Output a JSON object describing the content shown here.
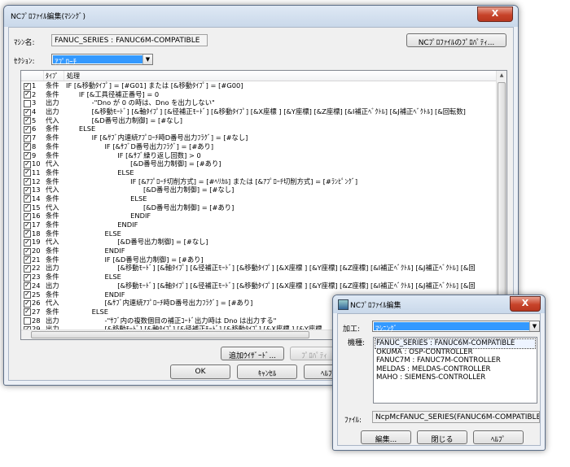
{
  "main_window": {
    "title": "NCﾌﾟﾛﾌｧｲﾙ編集(ﾏｼﾝｸﾞ)",
    "close_glyph": "X",
    "machine_label": "ﾏｼﾝ名:",
    "machine_value": "FANUC_SERIES : FANUC6M-COMPATIBLE",
    "properties_button": "NCﾌﾟﾛﾌｧｲﾙのﾌﾟﾛﾊﾟﾃｨ...",
    "section_label": "ｾｸｼｮﾝ:",
    "section_value": "ｱﾌﾟﾛｰﾁ",
    "columns": {
      "type": "ﾀｲﾌﾟ",
      "process": "処理"
    },
    "rows": [
      {
        "checked": true,
        "no": "1",
        "type": "条件",
        "text": "IF [&移動ﾀｲﾌﾟ] = [#G01] または [&移動ﾀｲﾌﾟ] = [#G00]"
      },
      {
        "checked": true,
        "no": "2",
        "type": "条件",
        "text": "      IF [&工具径補正番号] = 0"
      },
      {
        "checked": false,
        "no": "3",
        "type": "出力",
        "text": "            -\"Dno が 0 の時は、Dno を出力しない\""
      },
      {
        "checked": true,
        "no": "4",
        "type": "出力",
        "text": "            [&移動ﾓｰﾄﾞ] [&軸ﾀｲﾌﾟ] [&径補正ﾓｰﾄﾞ] [&移動ﾀｲﾌﾟ] [&X座標 ] [&Y座標] [&Z座標] [&I補正ﾍﾞｸﾄﾙ] [&J補正ﾍﾞｸﾄﾙ] [&回転数]"
      },
      {
        "checked": true,
        "no": "5",
        "type": "代入",
        "text": "            [&D番号出力制御] = [#なし]"
      },
      {
        "checked": true,
        "no": "6",
        "type": "条件",
        "text": "      ELSE"
      },
      {
        "checked": true,
        "no": "7",
        "type": "条件",
        "text": "            IF [&ｻﾌﾞ内連続ｱﾌﾟﾛｰﾁ時D番号出力ﾌﾗｸﾞ] = [#なし]"
      },
      {
        "checked": true,
        "no": "8",
        "type": "条件",
        "text": "                  IF [&ｻﾌﾞD番号出力ﾌﾗｸﾞ] = [#あり]"
      },
      {
        "checked": true,
        "no": "9",
        "type": "条件",
        "text": "                        IF [&ｻﾌﾞ繰り返し回数] > 0"
      },
      {
        "checked": true,
        "no": "10",
        "type": "代入",
        "text": "                              [&D番号出力制御] = [#あり]"
      },
      {
        "checked": true,
        "no": "11",
        "type": "条件",
        "text": "                        ELSE"
      },
      {
        "checked": true,
        "no": "12",
        "type": "条件",
        "text": "                              IF [&ｱﾌﾟﾛｰﾁ切削方式] = [#ﾍﾘｶﾙ] または [&ｱﾌﾟﾛｰﾁ切削方式] = [#ﾗﾝﾋﾟﾝｸﾞ]"
      },
      {
        "checked": true,
        "no": "13",
        "type": "代入",
        "text": "                                    [&D番号出力制御] = [#なし]"
      },
      {
        "checked": true,
        "no": "14",
        "type": "条件",
        "text": "                              ELSE"
      },
      {
        "checked": true,
        "no": "15",
        "type": "代入",
        "text": "                                    [&D番号出力制御] = [#あり]"
      },
      {
        "checked": true,
        "no": "16",
        "type": "条件",
        "text": "                              ENDIF"
      },
      {
        "checked": true,
        "no": "17",
        "type": "条件",
        "text": "                        ENDIF"
      },
      {
        "checked": true,
        "no": "18",
        "type": "条件",
        "text": "                  ELSE"
      },
      {
        "checked": true,
        "no": "19",
        "type": "代入",
        "text": "                        [&D番号出力制御] = [#なし]"
      },
      {
        "checked": true,
        "no": "20",
        "type": "条件",
        "text": "                  ENDIF"
      },
      {
        "checked": true,
        "no": "21",
        "type": "条件",
        "text": "                  IF [&D番号出力制御] = [#あり]"
      },
      {
        "checked": true,
        "no": "22",
        "type": "出力",
        "text": "                        [&移動ﾓｰﾄﾞ] [&軸ﾀｲﾌﾟ] [&径補正ﾓｰﾄﾞ] [&移動ﾀｲﾌﾟ] [&X座標 ] [&Y座標] [&Z座標] [&I補正ﾍﾞｸﾄﾙ] [&J補正ﾍﾞｸﾄﾙ] [&回"
      },
      {
        "checked": true,
        "no": "23",
        "type": "条件",
        "text": "                  ELSE"
      },
      {
        "checked": true,
        "no": "24",
        "type": "出力",
        "text": "                        [&移動ﾓｰﾄﾞ] [&軸ﾀｲﾌﾟ] [&径補正ﾓｰﾄﾞ] [&移動ﾀｲﾌﾟ] [&X座標 ] [&Y座標] [&Z座標] [&I補正ﾍﾞｸﾄﾙ] [&J補正ﾍﾞｸﾄﾙ] [&回"
      },
      {
        "checked": true,
        "no": "25",
        "type": "条件",
        "text": "                  ENDIF"
      },
      {
        "checked": true,
        "no": "26",
        "type": "代入",
        "text": "                  [&ｻﾌﾞ内連続ｱﾌﾟﾛｰﾁ時D番号出力ﾌﾗｸﾞ] = [#あり]"
      },
      {
        "checked": true,
        "no": "27",
        "type": "条件",
        "text": "            ELSE"
      },
      {
        "checked": false,
        "no": "28",
        "type": "出力",
        "text": "                  -\"ｻﾌﾞ内の複数個目の補正ｺｰﾄﾞ出力時は Dno は出力する\""
      },
      {
        "checked": true,
        "no": "29",
        "type": "出力",
        "text": "                  [&移動ﾓｰﾄﾞ] [&軸ﾀｲﾌﾟ] [&径補正ﾓｰﾄﾞ] [&移動ﾀｲﾌﾟ] [&X座標 ] [&Y座標"
      }
    ],
    "add_wizard_button": "追加ｳｲｻﾞｰﾄﾞ...",
    "property_button": "ﾌﾟﾛﾊﾟﾃｨ",
    "ok_button": "OK",
    "cancel_button": "ｷｬﾝｾﾙ",
    "help_button": "ﾍﾙﾌﾟ"
  },
  "sub_window": {
    "title": "NCﾌﾟﾛﾌｧｲﾙ編集",
    "close_glyph": "X",
    "process_label": "加工:",
    "process_value": "ﾏｼﾆﾝｸﾞ",
    "machine_type_label": "機種:",
    "machines": [
      "FANUC_SERIES : FANUC6M-COMPATIBLE",
      "OKUMA : OSP-CONTROLLER",
      "FANUC7M : FANUC7M-CONTROLLER",
      "MELDAS : MELDAS-CONTROLLER",
      "MAHO : SIEMENS-CONTROLLER"
    ],
    "file_label": "ﾌｧｲﾙ:",
    "file_value": "NcpMcFANUC_SERIES(FANUC6M-COMPATIBLE)",
    "edit_button": "編集...",
    "close_button": "閉じる",
    "help_button": "ﾍﾙﾌﾟ"
  }
}
